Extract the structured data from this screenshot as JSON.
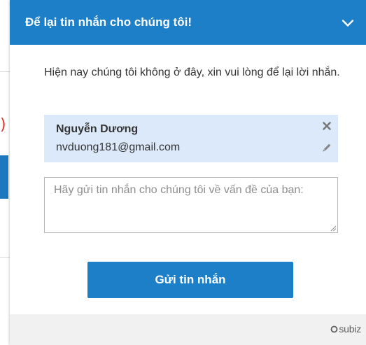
{
  "header": {
    "title": "Để lại tin nhắn cho chúng tôi!",
    "collapse_icon": "chevron-down-icon"
  },
  "intro_text": "Hiện nay chúng tôi không ở đây, xin vui lòng để lại lời nhắn.",
  "contact": {
    "name": "Nguyễn Dương",
    "email": "nvduong181@gmail.com",
    "remove_icon": "close-icon",
    "edit_icon": "pencil-icon"
  },
  "message": {
    "value": "",
    "placeholder": "Hãy gửi tin nhắn cho chúng tôi về vấn đề của bạn:"
  },
  "send_button_label": "Gửi tin nhắn",
  "footer": {
    "brand": "subiz"
  },
  "colors": {
    "primary": "#1e7fc9",
    "contact_bg": "#dce9fa",
    "footer_bg": "#f1f1f1",
    "text": "#333333"
  }
}
